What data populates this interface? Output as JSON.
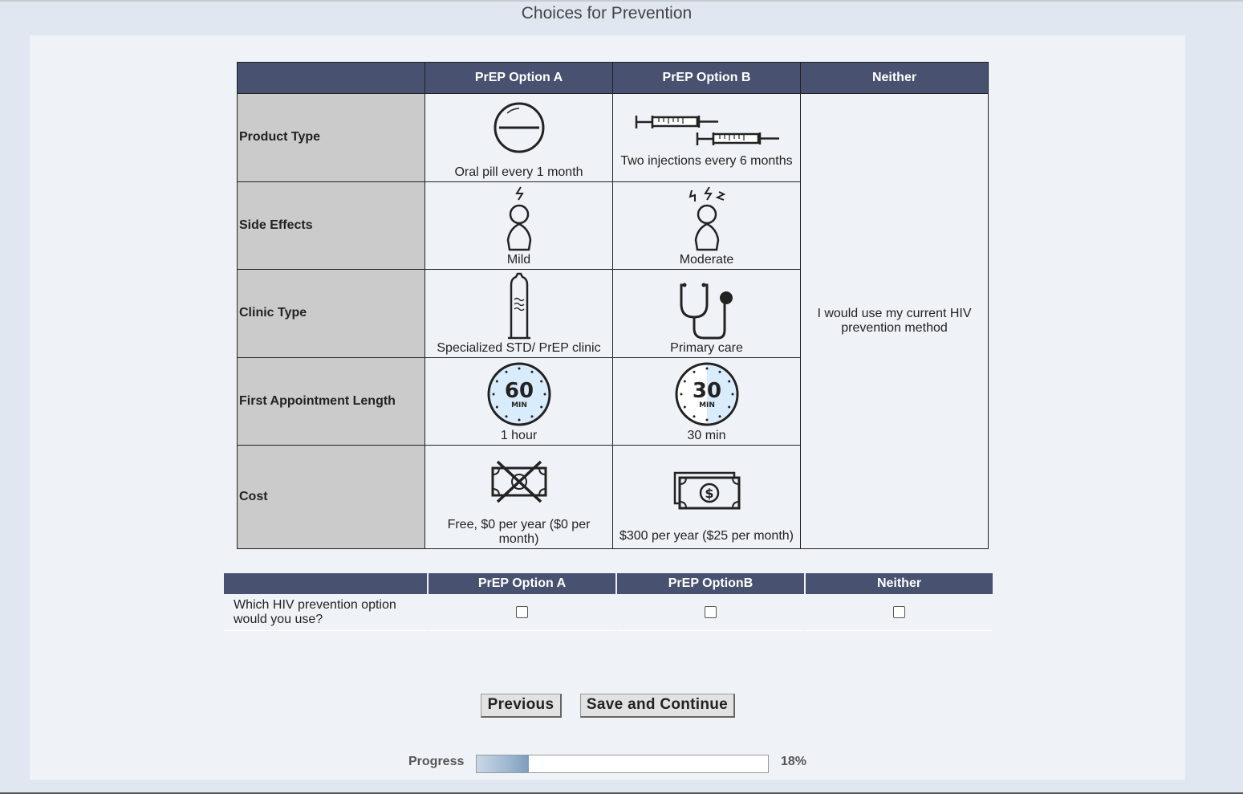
{
  "page_title": "Choices for Prevention",
  "attributes_table": {
    "headers": [
      "",
      "PrEP Option A",
      "PrEP Option B",
      "Neither"
    ],
    "rows": [
      {
        "name": "Product Type",
        "option_a": "Oral pill every 1 month",
        "option_b": "Two injections every 6 months",
        "icon_a": "pill-icon",
        "icon_b": "syringes-icon"
      },
      {
        "name": "Side Effects",
        "option_a": "Mild",
        "option_b": "Moderate",
        "icon_a": "mild-side-effect-icon",
        "icon_b": "moderate-side-effect-icon"
      },
      {
        "name": "Clinic Type",
        "option_a": "Specialized STD/ PrEP clinic",
        "option_b": "Primary care",
        "icon_a": "condom-icon",
        "icon_b": "stethoscope-icon"
      },
      {
        "name": "First Appointment Length",
        "option_a": "1 hour",
        "option_b": "30 min",
        "icon_a": "timer-60-icon",
        "icon_b": "timer-30-icon"
      },
      {
        "name": "Cost",
        "option_a": "Free, $0 per year ($0 per month)",
        "option_b": "$300 per year ($25 per month)",
        "icon_a": "no-money-icon",
        "icon_b": "money-icon"
      }
    ],
    "neither_text": "I would use my current HIV prevention method"
  },
  "timer_a": {
    "number": "60",
    "unit": "MIN"
  },
  "timer_b": {
    "number": "30",
    "unit": "MIN"
  },
  "choice_table": {
    "headers": [
      "",
      "PrEP Option A",
      "PrEP OptionB",
      "Neither"
    ],
    "question": "Which HIV prevention option would you use?"
  },
  "buttons": {
    "previous": "Previous",
    "save_continue": "Save and Continue"
  },
  "progress": {
    "label": "Progress",
    "percent": 18,
    "percent_text": "18%"
  },
  "colors": {
    "header_bg": "#485270",
    "attr_name_bg": "#cbcbcb",
    "cell_bg": "#eff3f8",
    "page_bg": "#e0e7f1"
  }
}
